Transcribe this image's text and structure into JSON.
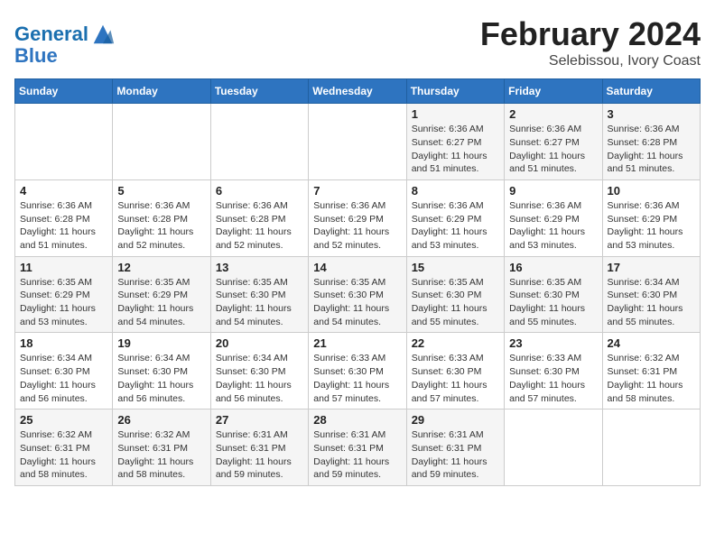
{
  "header": {
    "logo_line1": "General",
    "logo_line2": "Blue",
    "month": "February 2024",
    "location": "Selebissou, Ivory Coast"
  },
  "weekdays": [
    "Sunday",
    "Monday",
    "Tuesday",
    "Wednesday",
    "Thursday",
    "Friday",
    "Saturday"
  ],
  "weeks": [
    [
      {
        "day": "",
        "info": ""
      },
      {
        "day": "",
        "info": ""
      },
      {
        "day": "",
        "info": ""
      },
      {
        "day": "",
        "info": ""
      },
      {
        "day": "1",
        "info": "Sunrise: 6:36 AM\nSunset: 6:27 PM\nDaylight: 11 hours\nand 51 minutes."
      },
      {
        "day": "2",
        "info": "Sunrise: 6:36 AM\nSunset: 6:27 PM\nDaylight: 11 hours\nand 51 minutes."
      },
      {
        "day": "3",
        "info": "Sunrise: 6:36 AM\nSunset: 6:28 PM\nDaylight: 11 hours\nand 51 minutes."
      }
    ],
    [
      {
        "day": "4",
        "info": "Sunrise: 6:36 AM\nSunset: 6:28 PM\nDaylight: 11 hours\nand 51 minutes."
      },
      {
        "day": "5",
        "info": "Sunrise: 6:36 AM\nSunset: 6:28 PM\nDaylight: 11 hours\nand 52 minutes."
      },
      {
        "day": "6",
        "info": "Sunrise: 6:36 AM\nSunset: 6:28 PM\nDaylight: 11 hours\nand 52 minutes."
      },
      {
        "day": "7",
        "info": "Sunrise: 6:36 AM\nSunset: 6:29 PM\nDaylight: 11 hours\nand 52 minutes."
      },
      {
        "day": "8",
        "info": "Sunrise: 6:36 AM\nSunset: 6:29 PM\nDaylight: 11 hours\nand 53 minutes."
      },
      {
        "day": "9",
        "info": "Sunrise: 6:36 AM\nSunset: 6:29 PM\nDaylight: 11 hours\nand 53 minutes."
      },
      {
        "day": "10",
        "info": "Sunrise: 6:36 AM\nSunset: 6:29 PM\nDaylight: 11 hours\nand 53 minutes."
      }
    ],
    [
      {
        "day": "11",
        "info": "Sunrise: 6:35 AM\nSunset: 6:29 PM\nDaylight: 11 hours\nand 53 minutes."
      },
      {
        "day": "12",
        "info": "Sunrise: 6:35 AM\nSunset: 6:29 PM\nDaylight: 11 hours\nand 54 minutes."
      },
      {
        "day": "13",
        "info": "Sunrise: 6:35 AM\nSunset: 6:30 PM\nDaylight: 11 hours\nand 54 minutes."
      },
      {
        "day": "14",
        "info": "Sunrise: 6:35 AM\nSunset: 6:30 PM\nDaylight: 11 hours\nand 54 minutes."
      },
      {
        "day": "15",
        "info": "Sunrise: 6:35 AM\nSunset: 6:30 PM\nDaylight: 11 hours\nand 55 minutes."
      },
      {
        "day": "16",
        "info": "Sunrise: 6:35 AM\nSunset: 6:30 PM\nDaylight: 11 hours\nand 55 minutes."
      },
      {
        "day": "17",
        "info": "Sunrise: 6:34 AM\nSunset: 6:30 PM\nDaylight: 11 hours\nand 55 minutes."
      }
    ],
    [
      {
        "day": "18",
        "info": "Sunrise: 6:34 AM\nSunset: 6:30 PM\nDaylight: 11 hours\nand 56 minutes."
      },
      {
        "day": "19",
        "info": "Sunrise: 6:34 AM\nSunset: 6:30 PM\nDaylight: 11 hours\nand 56 minutes."
      },
      {
        "day": "20",
        "info": "Sunrise: 6:34 AM\nSunset: 6:30 PM\nDaylight: 11 hours\nand 56 minutes."
      },
      {
        "day": "21",
        "info": "Sunrise: 6:33 AM\nSunset: 6:30 PM\nDaylight: 11 hours\nand 57 minutes."
      },
      {
        "day": "22",
        "info": "Sunrise: 6:33 AM\nSunset: 6:30 PM\nDaylight: 11 hours\nand 57 minutes."
      },
      {
        "day": "23",
        "info": "Sunrise: 6:33 AM\nSunset: 6:30 PM\nDaylight: 11 hours\nand 57 minutes."
      },
      {
        "day": "24",
        "info": "Sunrise: 6:32 AM\nSunset: 6:31 PM\nDaylight: 11 hours\nand 58 minutes."
      }
    ],
    [
      {
        "day": "25",
        "info": "Sunrise: 6:32 AM\nSunset: 6:31 PM\nDaylight: 11 hours\nand 58 minutes."
      },
      {
        "day": "26",
        "info": "Sunrise: 6:32 AM\nSunset: 6:31 PM\nDaylight: 11 hours\nand 58 minutes."
      },
      {
        "day": "27",
        "info": "Sunrise: 6:31 AM\nSunset: 6:31 PM\nDaylight: 11 hours\nand 59 minutes."
      },
      {
        "day": "28",
        "info": "Sunrise: 6:31 AM\nSunset: 6:31 PM\nDaylight: 11 hours\nand 59 minutes."
      },
      {
        "day": "29",
        "info": "Sunrise: 6:31 AM\nSunset: 6:31 PM\nDaylight: 11 hours\nand 59 minutes."
      },
      {
        "day": "",
        "info": ""
      },
      {
        "day": "",
        "info": ""
      }
    ]
  ]
}
